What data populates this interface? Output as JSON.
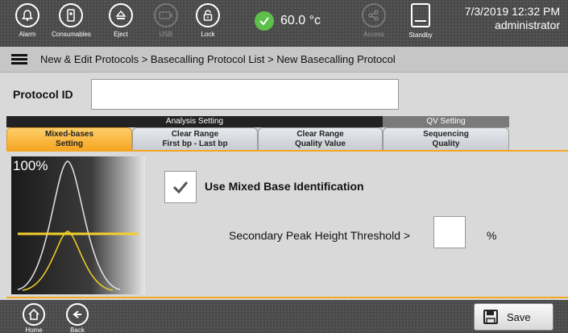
{
  "topbar": {
    "buttons": [
      {
        "label": "Alarm",
        "icon": "bell-icon"
      },
      {
        "label": "Consumables",
        "icon": "consumables-icon"
      },
      {
        "label": "Eject",
        "icon": "eject-icon"
      },
      {
        "label": "USB",
        "icon": "usb-icon"
      },
      {
        "label": "Lock",
        "icon": "lock-icon"
      }
    ],
    "temperature": "60.0 °c",
    "access_label": "Access",
    "standby_label": "Standby",
    "date_time": "7/3/2019 12:32 PM",
    "user": "administrator"
  },
  "breadcrumb": "New & Edit Protocols > Basecalling Protocol List > New Basecalling Protocol",
  "protocol_id": {
    "label": "Protocol ID",
    "value": ""
  },
  "tab_groups": {
    "analysis": "Analysis Setting",
    "qv": "QV Setting"
  },
  "tabs": [
    {
      "line1": "Mixed-bases",
      "line2": "Setting"
    },
    {
      "line1": "Clear Range",
      "line2": "First bp - Last bp"
    },
    {
      "line1": "Clear Range",
      "line2": "Quality Value"
    },
    {
      "line1": "Sequencing",
      "line2": "Quality"
    }
  ],
  "mixed_bases": {
    "image_label": "100%",
    "checkbox_label": "Use Mixed Base Identification",
    "checked": true,
    "threshold_label": "Secondary Peak Height  Threshold  >",
    "threshold_value": "",
    "threshold_unit": "%"
  },
  "bottombar": {
    "home_label": "Home",
    "back_label": "Back",
    "save_label": "Save"
  },
  "colors": {
    "accent": "#f5a623",
    "ok": "#5dc04a",
    "bar": "#4a4a4a"
  }
}
